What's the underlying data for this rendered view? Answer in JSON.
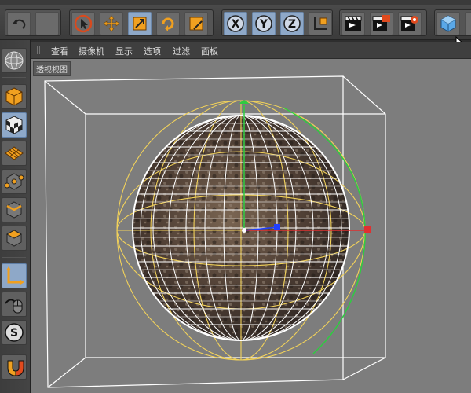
{
  "toolbar": {
    "undo": "undo",
    "tools": [
      "select",
      "move",
      "scale",
      "rotate",
      "convert"
    ],
    "axes": [
      "X",
      "Y",
      "Z"
    ],
    "render": [
      "render-region",
      "render-to-viewer",
      "render-settings"
    ],
    "object": "cube"
  },
  "viewport_menu": {
    "items": [
      "查看",
      "摄像机",
      "显示",
      "选项",
      "过滤",
      "面板"
    ]
  },
  "viewport": {
    "label": "透视视图"
  },
  "sidebar": {
    "items": [
      "model-mode",
      "texture-mode",
      "workplane",
      "points-mode",
      "edges-mode",
      "polygons-mode",
      "axis-mode",
      "tweak-mode",
      "solo-mode",
      "snap"
    ]
  },
  "colors": {
    "wire_white": "#ffffff",
    "wire_yellow": "#f2d25a",
    "axis_x": "#e03030",
    "axis_y": "#2ecc40",
    "axis_z": "#2040ff",
    "active_blue": "#8ea8c8"
  }
}
